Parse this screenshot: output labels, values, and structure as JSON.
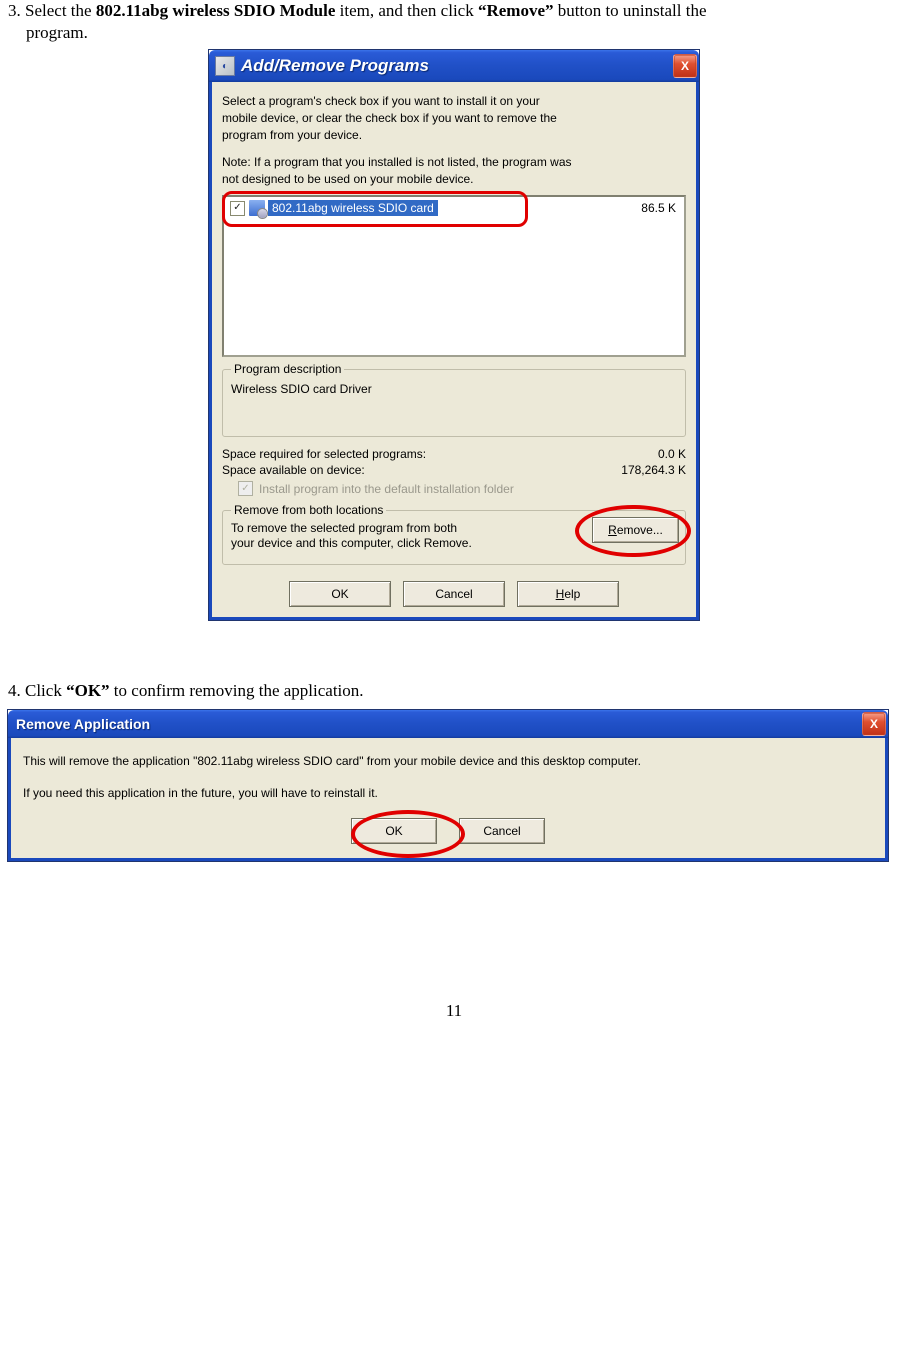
{
  "step3": {
    "prefix": "3. Select the ",
    "bold1": "802.11abg wireless SDIO Module",
    "mid": " item, and then click ",
    "bold2": "“Remove”",
    "suffix": " button to uninstall the",
    "line2": "program."
  },
  "dlg1": {
    "title": "Add/Remove Programs",
    "close": "X",
    "intro1": "Select a program's check box if you want to install it on your",
    "intro2": "mobile device, or clear the check box if you want to remove the",
    "intro3": "program from your device.",
    "note1": "Note:  If a program that you installed is not listed, the program was",
    "note2": "not designed to be used on your mobile device.",
    "item_name": "802.11abg wireless SDIO card",
    "item_size": "86.5 K",
    "desc_legend": "Program description",
    "desc_text": "Wireless SDIO card Driver",
    "space_req_label": "Space required for selected programs:",
    "space_req_val": "0.0 K",
    "space_avail_label": "Space available on device:",
    "space_avail_val": "178,264.3 K",
    "default_folder": "Install program into the default installation folder",
    "remove_legend": "Remove from both locations",
    "remove_text1": "To remove the selected program from both",
    "remove_text2": "your device and this computer, click Remove.",
    "remove_btn_pre": "R",
    "remove_btn_post": "emove...",
    "ok": "OK",
    "cancel": "Cancel",
    "help_pre": "H",
    "help_post": "elp"
  },
  "step4": {
    "prefix": "4. Click ",
    "bold": "“OK”",
    "suffix": " to confirm removing the application."
  },
  "dlg2": {
    "title": "Remove Application",
    "close": "X",
    "line1": "This will remove the application \"802.11abg wireless SDIO card\" from your mobile device and this desktop computer.",
    "line2": "If you need this application in the future, you will have to reinstall it.",
    "ok": "OK",
    "cancel": "Cancel"
  },
  "page_num": "11"
}
